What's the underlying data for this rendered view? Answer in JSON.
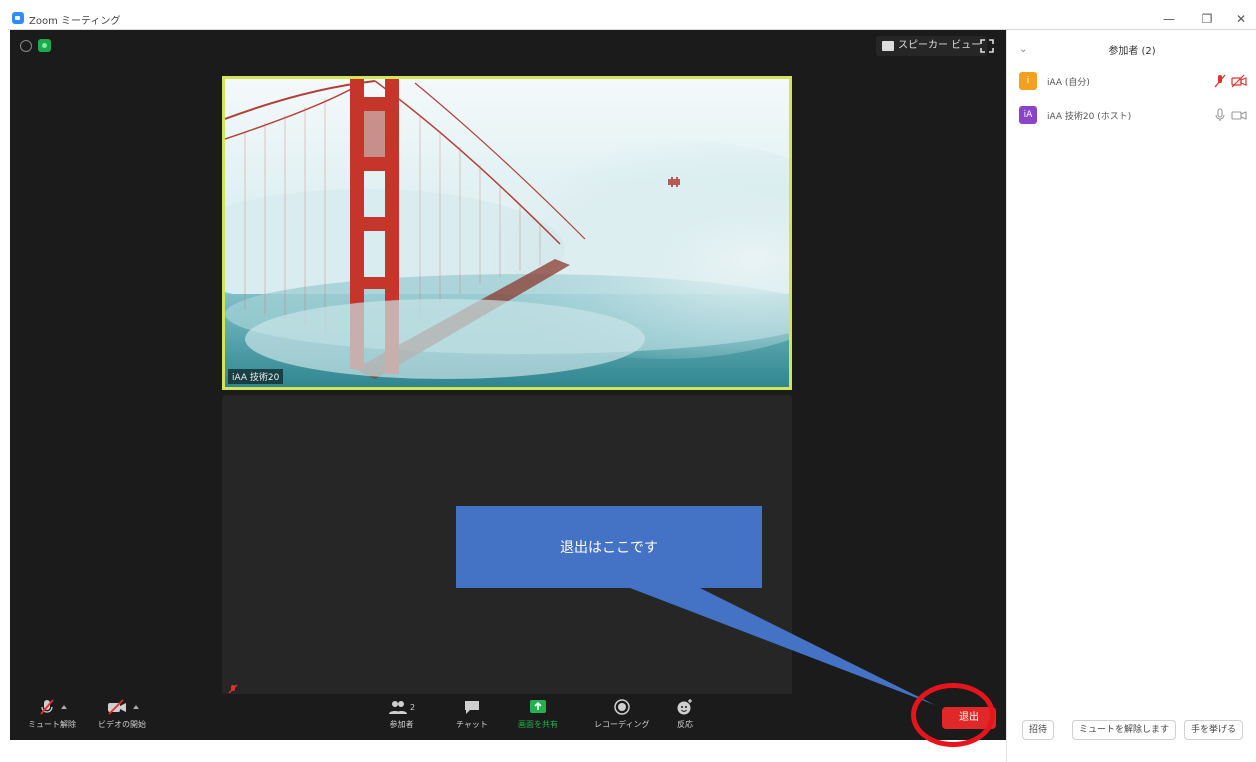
{
  "window": {
    "title": "Zoom ミーティング",
    "minimize_glyph": "—",
    "restore_glyph": "❐",
    "close_glyph": "✕"
  },
  "view": {
    "speaker_view_label": "スピーカー ビュー"
  },
  "video": {
    "name_tag": "iAA 技術20"
  },
  "toolbar": {
    "mute_label": "ミュート解除",
    "video_label": "ビデオの開始",
    "participants_label": "参加者",
    "participants_count": "2",
    "chat_label": "チャット",
    "share_label": "画面を共有",
    "record_label": "レコーディング",
    "reactions_label": "反応",
    "leave_label": "退出"
  },
  "callout": {
    "text": "退出はここです"
  },
  "panel": {
    "title": "参加者 (2)",
    "collapse_glyph": "⌄",
    "participants": [
      {
        "name": "iAA (自分)",
        "avatar": "i",
        "avatar_color": "#f2a01e"
      },
      {
        "name": "iAA 技術20 (ホスト)",
        "avatar": "iA",
        "avatar_color": "#8a44c8"
      }
    ],
    "invite_label": "招待",
    "unmute_me_label": "ミュートを解除します",
    "raise_hand_label": "手を挙げる"
  },
  "colors": {
    "accent_green": "#1fa84f",
    "leave_red": "#e02828",
    "highlight_circle": "#e8141b",
    "callout_blue": "#4472c4",
    "speaker_border": "#d4e45a"
  }
}
